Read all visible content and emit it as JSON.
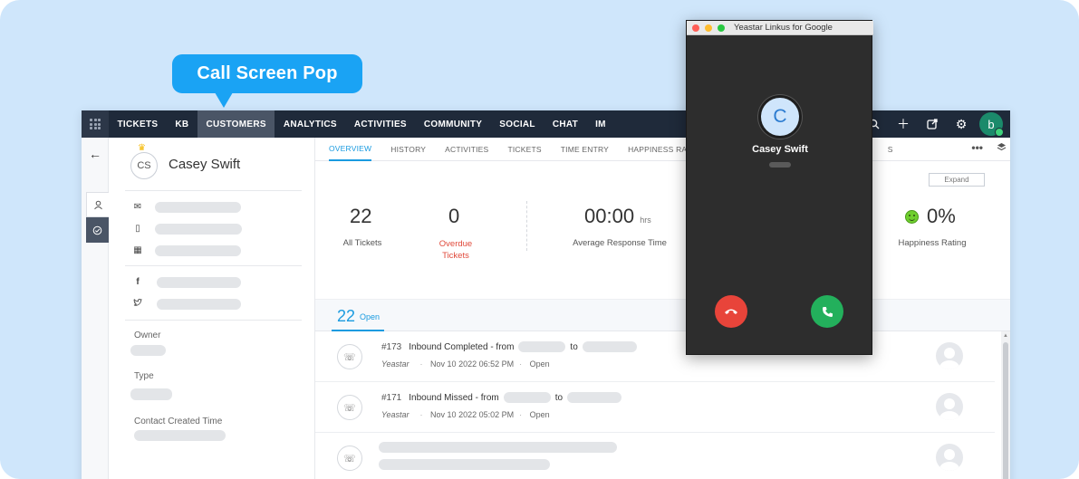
{
  "callout": {
    "label": "Call Screen Pop"
  },
  "topnav": {
    "items": [
      "TICKETS",
      "KB",
      "CUSTOMERS",
      "ANALYTICS",
      "ACTIVITIES",
      "COMMUNITY",
      "SOCIAL",
      "CHAT",
      "IM"
    ],
    "active": "CUSTOMERS",
    "avatar_letter": "b"
  },
  "customer": {
    "initials": "CS",
    "name": "Casey Swift",
    "fields": {
      "owner_label": "Owner",
      "type_label": "Type",
      "created_label": "Contact Created Time"
    }
  },
  "subtabs": {
    "items": [
      "OVERVIEW",
      "HISTORY",
      "ACTIVITIES",
      "TICKETS",
      "TIME ENTRY",
      "HAPPINESS RATING"
    ],
    "active": "OVERVIEW",
    "hidden_tail": "S"
  },
  "stats": {
    "expand_label": "Expand",
    "all_tickets": {
      "value": "22",
      "label": "All Tickets"
    },
    "overdue": {
      "value": "0",
      "label_line1": "Overdue",
      "label_line2": "Tickets"
    },
    "response": {
      "value": "00:00",
      "unit": "hrs",
      "label": "Average Response Time"
    },
    "happiness": {
      "value": "0%",
      "label": "Happiness Rating"
    }
  },
  "open": {
    "count": "22",
    "label": "Open"
  },
  "tickets": [
    {
      "number": "#173",
      "text_a": "Inbound Completed - from",
      "text_b": "to",
      "source": "Yeastar",
      "date": "Nov 10 2022 06:52 PM",
      "status": "Open"
    },
    {
      "number": "#171",
      "text_a": "Inbound Missed - from",
      "text_b": "to",
      "source": "Yeastar",
      "date": "Nov 10 2022 05:02 PM",
      "status": "Open"
    }
  ],
  "popup": {
    "title": "Yeastar Linkus for Google",
    "avatar_letter": "C",
    "caller_name": "Casey Swift"
  },
  "colors": {
    "accent": "#1a9be0",
    "nav_bg": "#1f2a3a",
    "callout": "#1aa3f4",
    "decline": "#e8443a",
    "answer": "#23b05c"
  }
}
